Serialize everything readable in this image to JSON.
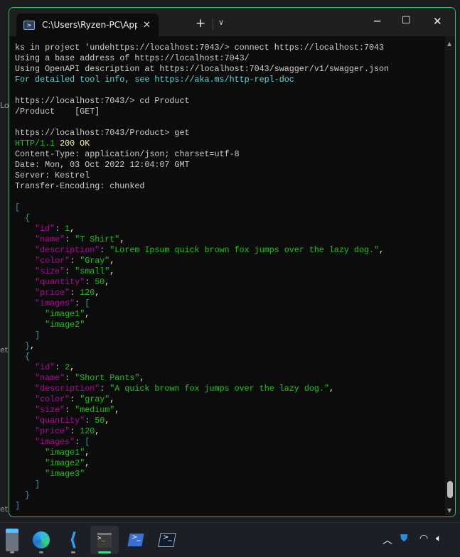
{
  "background_window": {
    "fragments": [
      "Lo",
      "et",
      "et"
    ]
  },
  "window": {
    "tab_title": "C:\\Users\\Ryzen-PC\\AppData\\l",
    "tab_icon": "powershell-icon",
    "accent": "#2dbd6e"
  },
  "terminal": {
    "lines": [
      [
        [
          "ks in project 'undehttps://localhost:7043/> connect https://localhost:7043",
          "def"
        ]
      ],
      [
        [
          "Using a base address of https://localhost:7043/",
          "def"
        ]
      ],
      [
        [
          "Using OpenAPI description at https://localhost:7043/swagger/v1/swagger.json",
          "def"
        ]
      ],
      [
        [
          "For detailed tool info, see https://aka.ms/http-repl-doc",
          "cyan"
        ]
      ],
      [],
      [
        [
          "https://localhost:7043/> cd Product",
          "def"
        ]
      ],
      [
        [
          "/Product    [GET]",
          "def"
        ]
      ],
      [],
      [
        [
          "https://localhost:7043/Product> get",
          "def"
        ]
      ],
      [
        [
          "HTTP/1.1 ",
          "green"
        ],
        [
          "200 OK",
          "yellow"
        ]
      ],
      [
        [
          "Content-Type: application/json; charset=utf-8",
          "def"
        ]
      ],
      [
        [
          "Date: Mon, 03 Oct 2022 12:04:07 GMT",
          "def"
        ]
      ],
      [
        [
          "Server: Kestrel",
          "def"
        ]
      ],
      [
        [
          "Transfer-Encoding: chunked",
          "def"
        ]
      ],
      [],
      [
        [
          "[",
          "br"
        ]
      ],
      [
        [
          "  {",
          "br"
        ]
      ],
      [
        [
          "    ",
          "def"
        ],
        [
          "\"id\"",
          "key"
        ],
        [
          ": ",
          "def"
        ],
        [
          "1",
          "num"
        ],
        [
          ",",
          "punct"
        ]
      ],
      [
        [
          "    ",
          "def"
        ],
        [
          "\"name\"",
          "key"
        ],
        [
          ": ",
          "def"
        ],
        [
          "\"T Shirt\"",
          "str"
        ],
        [
          ",",
          "punct"
        ]
      ],
      [
        [
          "    ",
          "def"
        ],
        [
          "\"description\"",
          "key"
        ],
        [
          ": ",
          "def"
        ],
        [
          "\"Lorem Ipsum quick brown fox jumps over the lazy dog.\"",
          "str"
        ],
        [
          ",",
          "punct"
        ]
      ],
      [
        [
          "    ",
          "def"
        ],
        [
          "\"color\"",
          "key"
        ],
        [
          ": ",
          "def"
        ],
        [
          "\"Gray\"",
          "str"
        ],
        [
          ",",
          "punct"
        ]
      ],
      [
        [
          "    ",
          "def"
        ],
        [
          "\"size\"",
          "key"
        ],
        [
          ": ",
          "def"
        ],
        [
          "\"small\"",
          "str"
        ],
        [
          ",",
          "punct"
        ]
      ],
      [
        [
          "    ",
          "def"
        ],
        [
          "\"quantity\"",
          "key"
        ],
        [
          ": ",
          "def"
        ],
        [
          "50",
          "num"
        ],
        [
          ",",
          "punct"
        ]
      ],
      [
        [
          "    ",
          "def"
        ],
        [
          "\"price\"",
          "key"
        ],
        [
          ": ",
          "def"
        ],
        [
          "120",
          "num"
        ],
        [
          ",",
          "punct"
        ]
      ],
      [
        [
          "    ",
          "def"
        ],
        [
          "\"images\"",
          "key"
        ],
        [
          ": ",
          "def"
        ],
        [
          "[",
          "br"
        ]
      ],
      [
        [
          "      ",
          "def"
        ],
        [
          "\"image1\"",
          "str"
        ],
        [
          ",",
          "punct"
        ]
      ],
      [
        [
          "      ",
          "def"
        ],
        [
          "\"image2\"",
          "str"
        ]
      ],
      [
        [
          "    ]",
          "br"
        ]
      ],
      [
        [
          "  }",
          "br"
        ],
        [
          ",",
          "punct"
        ]
      ],
      [
        [
          "  {",
          "br"
        ]
      ],
      [
        [
          "    ",
          "def"
        ],
        [
          "\"id\"",
          "key"
        ],
        [
          ": ",
          "def"
        ],
        [
          "2",
          "num"
        ],
        [
          ",",
          "punct"
        ]
      ],
      [
        [
          "    ",
          "def"
        ],
        [
          "\"name\"",
          "key"
        ],
        [
          ": ",
          "def"
        ],
        [
          "\"Short Pants\"",
          "str"
        ],
        [
          ",",
          "punct"
        ]
      ],
      [
        [
          "    ",
          "def"
        ],
        [
          "\"description\"",
          "key"
        ],
        [
          ": ",
          "def"
        ],
        [
          "\"A quick brown fox jumps over the lazy dog.\"",
          "str"
        ],
        [
          ",",
          "punct"
        ]
      ],
      [
        [
          "    ",
          "def"
        ],
        [
          "\"color\"",
          "key"
        ],
        [
          ": ",
          "def"
        ],
        [
          "\"gray\"",
          "str"
        ],
        [
          ",",
          "punct"
        ]
      ],
      [
        [
          "    ",
          "def"
        ],
        [
          "\"size\"",
          "key"
        ],
        [
          ": ",
          "def"
        ],
        [
          "\"medium\"",
          "str"
        ],
        [
          ",",
          "punct"
        ]
      ],
      [
        [
          "    ",
          "def"
        ],
        [
          "\"quantity\"",
          "key"
        ],
        [
          ": ",
          "def"
        ],
        [
          "50",
          "num"
        ],
        [
          ",",
          "punct"
        ]
      ],
      [
        [
          "    ",
          "def"
        ],
        [
          "\"price\"",
          "key"
        ],
        [
          ": ",
          "def"
        ],
        [
          "120",
          "num"
        ],
        [
          ",",
          "punct"
        ]
      ],
      [
        [
          "    ",
          "def"
        ],
        [
          "\"images\"",
          "key"
        ],
        [
          ": ",
          "def"
        ],
        [
          "[",
          "br"
        ]
      ],
      [
        [
          "      ",
          "def"
        ],
        [
          "\"image1\"",
          "str"
        ],
        [
          ",",
          "punct"
        ]
      ],
      [
        [
          "      ",
          "def"
        ],
        [
          "\"image2\"",
          "str"
        ],
        [
          ",",
          "punct"
        ]
      ],
      [
        [
          "      ",
          "def"
        ],
        [
          "\"image3\"",
          "str"
        ]
      ],
      [
        [
          "    ]",
          "br"
        ]
      ],
      [
        [
          "  }",
          "br"
        ]
      ],
      [
        [
          "]",
          "br"
        ]
      ]
    ],
    "scroll_position_percent": 100
  },
  "taskbar": {
    "apps": [
      "calculator-icon",
      "edge-icon",
      "vscode-icon",
      "terminal-icon",
      "powershell-icon",
      "powershell-dark-icon"
    ],
    "active_app": "terminal-icon",
    "tray": [
      "chevron-up-icon",
      "security-shield-icon",
      "wifi-icon",
      "volume-icon"
    ]
  }
}
